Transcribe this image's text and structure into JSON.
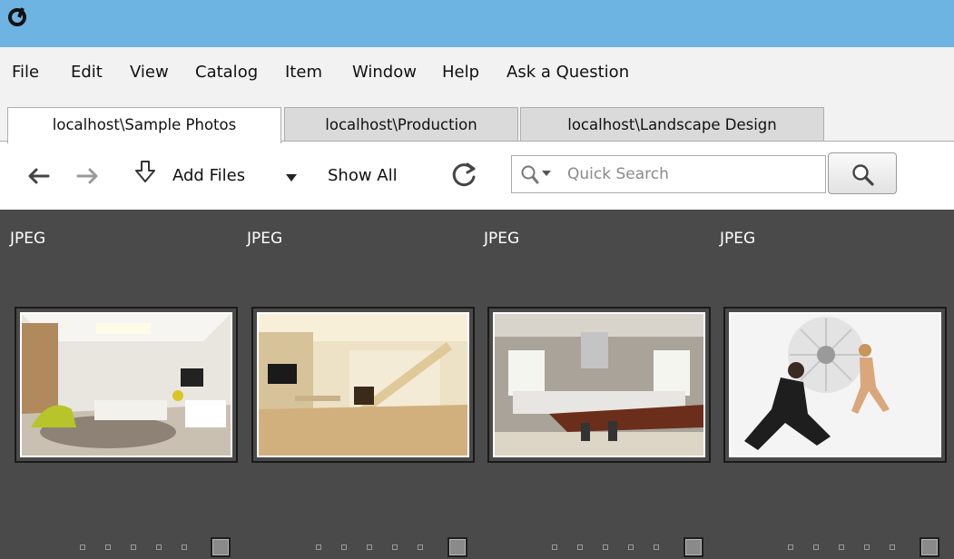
{
  "app": {
    "logo_icon": "app-logo-icon"
  },
  "menu": [
    "File",
    "Edit",
    "View",
    "Catalog",
    "Item",
    "Window",
    "Help",
    "Ask a Question"
  ],
  "tabs": [
    {
      "label": "localhost\\Sample Photos",
      "active": true
    },
    {
      "label": "localhost\\Production",
      "active": false
    },
    {
      "label": "localhost\\Landscape Design",
      "active": false
    }
  ],
  "toolbar": {
    "back_icon": "arrow-left-icon",
    "forward_icon": "arrow-right-icon",
    "add_files_label": "Add Files",
    "show_all_label": "Show All",
    "refresh_icon": "refresh-icon",
    "search_placeholder": "Quick Search",
    "search_button_icon": "magnifier-icon"
  },
  "items": [
    {
      "type": "JPEG",
      "thumb": "living-room"
    },
    {
      "type": "JPEG",
      "thumb": "staircase-room"
    },
    {
      "type": "JPEG",
      "thumb": "kitchen"
    },
    {
      "type": "JPEG",
      "thumb": "photo-studio"
    }
  ],
  "colors": {
    "titlebar": "#6db4e3",
    "grid_background": "#4a4a4a",
    "menubar": "#f2f2f2"
  }
}
